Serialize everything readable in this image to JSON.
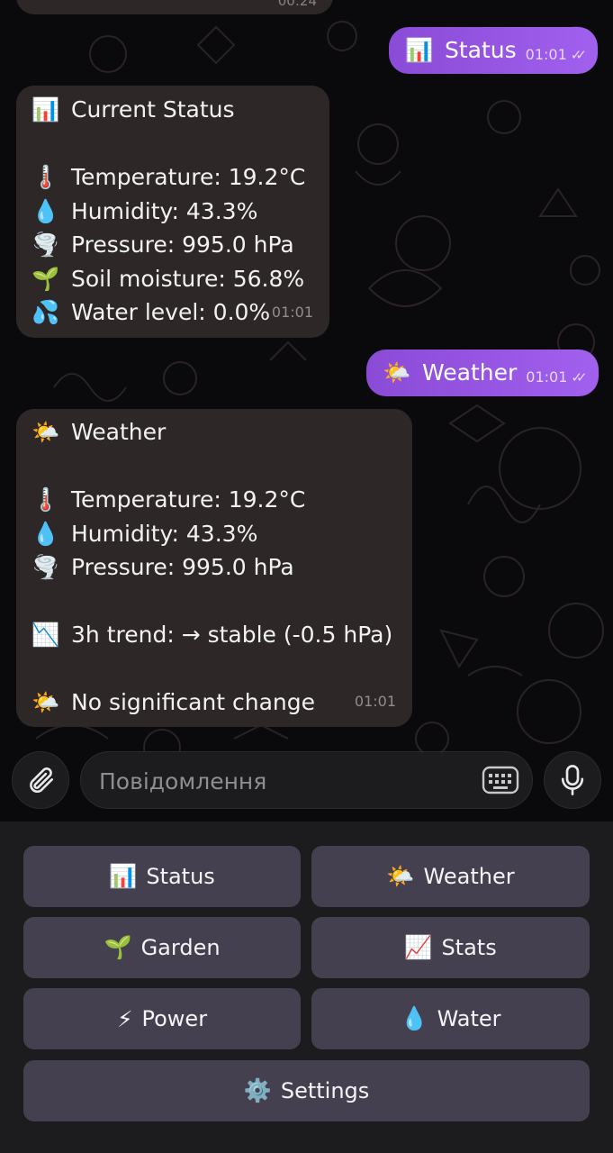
{
  "chat": {
    "prev_time": "00:24",
    "out1": {
      "emoji": "📊",
      "label": "Status",
      "time": "01:01",
      "check": "✓✓"
    },
    "status_msg": {
      "lines": [
        {
          "emoji": "📊",
          "text": "Current Status"
        },
        {
          "emoji": "",
          "text": ""
        },
        {
          "emoji": "🌡️",
          "text": "Temperature: 19.2°C"
        },
        {
          "emoji": "💧",
          "text": "Humidity: 43.3%"
        },
        {
          "emoji": "🌪️",
          "text": "Pressure: 995.0 hPa"
        },
        {
          "emoji": "🌱",
          "text": "Soil moisture: 56.8%"
        },
        {
          "emoji": "💦",
          "text": "Water level: 0.0%"
        }
      ],
      "time": "01:01"
    },
    "out2": {
      "emoji": "🌤️",
      "label": "Weather",
      "time": "01:01",
      "check": "✓✓"
    },
    "weather_msg": {
      "lines": [
        {
          "emoji": "🌤️",
          "text": "Weather"
        },
        {
          "emoji": "",
          "text": ""
        },
        {
          "emoji": "🌡️",
          "text": "Temperature: 19.2°C"
        },
        {
          "emoji": "💧",
          "text": "Humidity: 43.3%"
        },
        {
          "emoji": "🌪️",
          "text": "Pressure: 995.0 hPa"
        },
        {
          "emoji": "",
          "text": ""
        },
        {
          "emoji": "📉",
          "text": "3h trend: → stable (-0.5 hPa)"
        },
        {
          "emoji": "",
          "text": ""
        },
        {
          "emoji": "🌤️",
          "text": "No significant change"
        }
      ],
      "time": "01:01"
    }
  },
  "composer": {
    "placeholder": "Повідомлення",
    "attach_icon": "paperclip-icon",
    "keyboard_icon": "keyboard-icon",
    "mic_icon": "microphone-icon"
  },
  "keyboard": {
    "buttons": [
      {
        "emoji": "📊",
        "label": "Status"
      },
      {
        "emoji": "🌤️",
        "label": "Weather"
      },
      {
        "emoji": "🌱",
        "label": "Garden"
      },
      {
        "emoji": "📈",
        "label": "Stats"
      },
      {
        "emoji": "⚡",
        "label": "Power"
      },
      {
        "emoji": "💧",
        "label": "Water"
      },
      {
        "emoji": "⚙️",
        "label": "Settings"
      }
    ]
  },
  "colors": {
    "outgoing_bubble": "#9656e6",
    "incoming_bubble": "#2e2728",
    "keyboard_button": "#45404f",
    "background": "#0a0a0c"
  }
}
